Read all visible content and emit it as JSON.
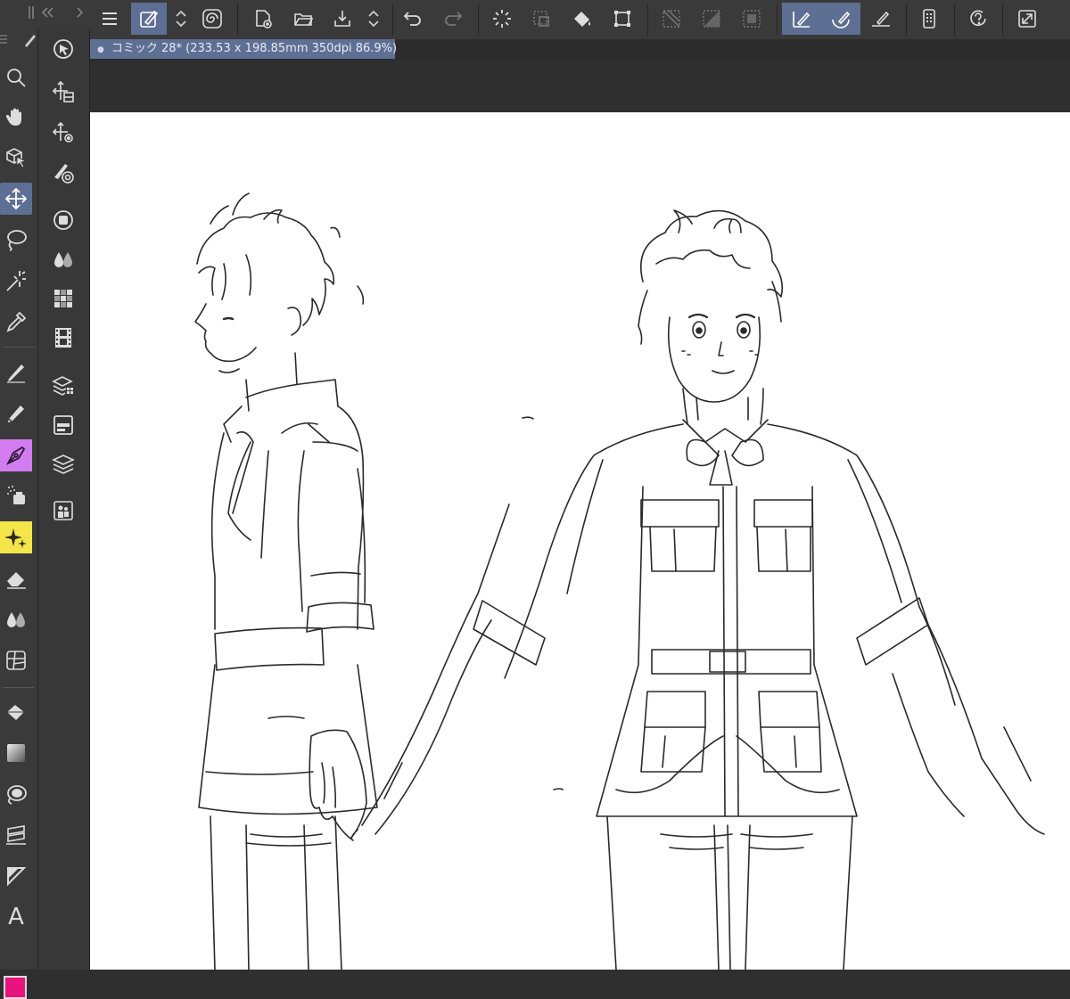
{
  "app": {
    "document_tab": {
      "title": "コミック 28* (233.53 x 198.85mm 350dpi 86.9%)",
      "modified_dot": "●"
    }
  },
  "toolbar": {
    "items": [
      {
        "name": "menu",
        "icon": "menu-icon"
      },
      {
        "name": "edit-mode",
        "icon": "pen-edit-icon",
        "active": true
      },
      {
        "name": "stepper",
        "icon": "up-down-icon"
      },
      {
        "name": "spiral",
        "icon": "spiral-icon"
      },
      {
        "name": "new-file",
        "icon": "new-file-icon"
      },
      {
        "name": "open-file",
        "icon": "folder-icon"
      },
      {
        "name": "save",
        "icon": "save-icon"
      },
      {
        "name": "save-stepper",
        "icon": "up-down-icon"
      },
      {
        "name": "undo",
        "icon": "undo-icon"
      },
      {
        "name": "redo",
        "icon": "redo-icon"
      },
      {
        "name": "deselect",
        "icon": "loading-ring-icon"
      },
      {
        "name": "selection-clear",
        "icon": "selection-dotted-icon"
      },
      {
        "name": "fill",
        "icon": "fill-icon"
      },
      {
        "name": "transform",
        "icon": "transform-icon"
      },
      {
        "name": "hatch-1",
        "icon": "hatch-icon"
      },
      {
        "name": "hatch-2",
        "icon": "hatch-fill-icon"
      },
      {
        "name": "selection-box",
        "icon": "selection-box-icon"
      },
      {
        "name": "ruler-snap",
        "icon": "ruler-pen-icon",
        "active": true
      },
      {
        "name": "brush-snap",
        "icon": "brush-snap-icon",
        "active": true
      },
      {
        "name": "ruler-line",
        "icon": "ruler-line-icon"
      },
      {
        "name": "device",
        "icon": "device-icon"
      },
      {
        "name": "help",
        "icon": "help-icon"
      },
      {
        "name": "fullscreen",
        "icon": "expand-icon"
      }
    ]
  },
  "tools_left": [
    {
      "name": "zoom",
      "icon": "magnifier-icon"
    },
    {
      "name": "hand",
      "icon": "hand-icon"
    },
    {
      "name": "object",
      "icon": "cube-pointer-icon"
    },
    {
      "name": "move",
      "icon": "move-icon",
      "active": true
    },
    {
      "name": "lasso",
      "icon": "lasso-icon"
    },
    {
      "name": "magic-wand",
      "icon": "magic-wand-icon"
    },
    {
      "name": "eyedropper",
      "icon": "eyedropper-icon"
    },
    {
      "name": "pen",
      "icon": "pen-icon"
    },
    {
      "name": "pencil",
      "icon": "pencil-icon"
    },
    {
      "name": "ink-pen",
      "icon": "ink-pen-icon",
      "highlight": "pink"
    },
    {
      "name": "airbrush",
      "icon": "airbrush-icon"
    },
    {
      "name": "decoration",
      "icon": "sparkle-icon",
      "highlight": "yellow"
    },
    {
      "name": "eraser",
      "icon": "eraser-icon"
    },
    {
      "name": "blend",
      "icon": "drops-icon"
    },
    {
      "name": "frame",
      "icon": "frame-icon"
    },
    {
      "name": "fill",
      "icon": "fill-bucket-icon"
    },
    {
      "name": "gradient",
      "icon": "gradient-icon"
    },
    {
      "name": "contour-fill",
      "icon": "contour-icon"
    },
    {
      "name": "ruler",
      "icon": "ruler-tool-icon"
    },
    {
      "name": "figure",
      "icon": "triangle-icon"
    },
    {
      "name": "text",
      "icon": "text-icon",
      "label": "A"
    }
  ],
  "tools_sub": [
    {
      "name": "operation",
      "icon": "target-arrow-icon"
    },
    {
      "name": "move-layer",
      "icon": "move-layer-icon"
    },
    {
      "name": "move-settings",
      "icon": "move-gear-icon"
    },
    {
      "name": "brush-settings",
      "icon": "brush-target-icon"
    },
    {
      "name": "sub-view",
      "icon": "circle-square-icon"
    },
    {
      "name": "color-mix",
      "icon": "drops-icon"
    },
    {
      "name": "grid",
      "icon": "grid-icon"
    },
    {
      "name": "animation",
      "icon": "film-icon"
    },
    {
      "name": "materials",
      "icon": "layers-settings-icon"
    },
    {
      "name": "layer-property",
      "icon": "layer-property-icon"
    },
    {
      "name": "layers",
      "icon": "layers-icon"
    },
    {
      "name": "ref-people",
      "icon": "people-icon"
    }
  ],
  "colors": {
    "toolbar_bg": "#3a3a3a",
    "accent": "#5e6f94",
    "canvas": "#ffffff",
    "main_color": "#e8137e"
  }
}
